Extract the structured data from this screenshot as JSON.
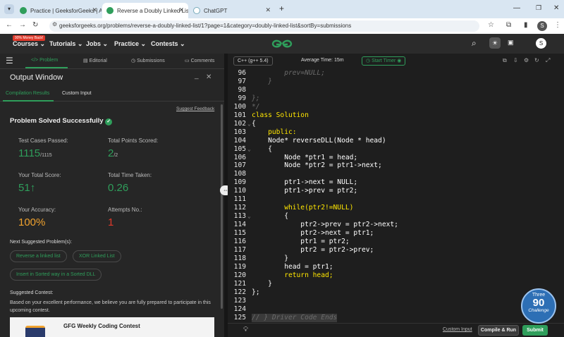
{
  "browser": {
    "tabs": [
      {
        "title": "Practice | GeeksforGeeks | A co"
      },
      {
        "title": "Reverse a Doubly Linked List | I"
      },
      {
        "title": "ChatGPT"
      }
    ],
    "url": "geeksforgeeks.org/problems/reverse-a-doubly-linked-list/1?page=1&category=doubly-linked-list&sortBy=submissions",
    "profile_letter": "S"
  },
  "gfg_nav": {
    "badge": "90% Money Back!",
    "items": [
      "Courses",
      "Tutorials",
      "Jobs",
      "Practice",
      "Contests"
    ],
    "logo": "GfG",
    "avatar": "S"
  },
  "problem_tabs": [
    "Problem",
    "Editorial",
    "Submissions",
    "Comments"
  ],
  "output": {
    "title": "Output Window",
    "tabs": [
      "Compilation Results",
      "Custom Input"
    ],
    "suggest_feedback": "Suggest Feedback",
    "solved": "Problem Solved Successfully",
    "stats": [
      {
        "label": "Test Cases Passed:",
        "value": "1115",
        "suffix": "/1115"
      },
      {
        "label": "Total Points Scored:",
        "value": "2",
        "suffix": "/2"
      },
      {
        "label": "Your Total Score:",
        "value": "51",
        "suffix": "↑"
      },
      {
        "label": "Total Time Taken:",
        "value": "0.26",
        "suffix": ""
      },
      {
        "label": "Your Accuracy:",
        "value": "100%",
        "suffix": ""
      },
      {
        "label": "Attempts No.:",
        "value": "1",
        "suffix": ""
      }
    ],
    "next_heading": "Next Suggested Problem(s):",
    "next_problems": [
      "Reverse a linked list",
      "XOR Linked List",
      "Insert in Sorted way in a Sorted DLL"
    ],
    "contest_heading": "Suggested Contest:",
    "contest_text": "Based on your excellent performance, we believe you are fully prepared to participate in this upcoming contest.",
    "contest_name": "GFG Weekly Coding Contest"
  },
  "editor": {
    "language": "C++ (g++ 5.4)",
    "avg_time": "Average Time: 15m",
    "timer": "Start Timer",
    "lines": [
      {
        "n": "96",
        "text": "        prev=NULL;",
        "cls": "cm"
      },
      {
        "n": "97",
        "text": "    }",
        "cls": "cm"
      },
      {
        "n": "98",
        "text": "",
        "cls": ""
      },
      {
        "n": "99",
        "text": "};",
        "cls": "cm"
      },
      {
        "n": "100",
        "text": "*/",
        "cls": "cm"
      },
      {
        "n": "101",
        "text": "class Solution",
        "cls": "kw"
      },
      {
        "n": "102",
        "text": "{",
        "cls": ""
      },
      {
        "n": "103",
        "text": "    public:",
        "cls": "kw"
      },
      {
        "n": "104",
        "text": "    Node* reverseDLL(Node * head)",
        "cls": ""
      },
      {
        "n": "105",
        "text": "    {",
        "cls": ""
      },
      {
        "n": "106",
        "text": "        Node *ptr1 = head;",
        "cls": ""
      },
      {
        "n": "107",
        "text": "        Node *ptr2 = ptr1->next;",
        "cls": ""
      },
      {
        "n": "108",
        "text": "",
        "cls": ""
      },
      {
        "n": "109",
        "text": "        ptr1->next = NULL;",
        "cls": ""
      },
      {
        "n": "110",
        "text": "        ptr1->prev = ptr2;",
        "cls": ""
      },
      {
        "n": "111",
        "text": "",
        "cls": ""
      },
      {
        "n": "112",
        "text": "        while(ptr2!=NULL)",
        "cls": "kw"
      },
      {
        "n": "113",
        "text": "        {",
        "cls": ""
      },
      {
        "n": "114",
        "text": "            ptr2->prev = ptr2->next;",
        "cls": ""
      },
      {
        "n": "115",
        "text": "            ptr2->next = ptr1;",
        "cls": ""
      },
      {
        "n": "116",
        "text": "            ptr1 = ptr2;",
        "cls": ""
      },
      {
        "n": "117",
        "text": "            ptr2 = ptr2->prev;",
        "cls": ""
      },
      {
        "n": "118",
        "text": "        }",
        "cls": ""
      },
      {
        "n": "119",
        "text": "        head = ptr1;",
        "cls": ""
      },
      {
        "n": "120",
        "text": "        return head;",
        "cls": "kw"
      },
      {
        "n": "121",
        "text": "    }",
        "cls": ""
      },
      {
        "n": "122",
        "text": "};",
        "cls": ""
      },
      {
        "n": "123",
        "text": "",
        "cls": ""
      },
      {
        "n": "124",
        "text": "",
        "cls": ""
      },
      {
        "n": "125",
        "text": "// } Driver Code Ends",
        "cls": "cm"
      }
    ],
    "custom_input": "Custom Input",
    "compile_run": "Compile & Run",
    "submit": "Submit",
    "challenge_top": "Three",
    "challenge_num": "90",
    "challenge_bottom": "Challenge"
  },
  "colors": {
    "accent_green": "#2f9e5b",
    "attempts_red": "#e0392b",
    "submit_green": "#2f9e5b"
  }
}
